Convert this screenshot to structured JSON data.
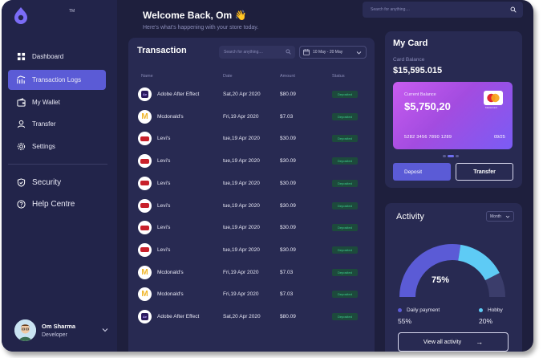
{
  "header": {
    "welcome": "Welcome Back, Om",
    "wave": "👋",
    "subtitle": "Here's what's happening with your store today.",
    "search_placeholder": "Search for anything...."
  },
  "sidebar": {
    "logo_tm": "TM",
    "items": [
      {
        "label": "Dashboard",
        "icon": "grid-icon"
      },
      {
        "label": "Transaction Logs",
        "icon": "chart-icon"
      },
      {
        "label": "My Wallet",
        "icon": "wallet-icon"
      },
      {
        "label": "Transfer",
        "icon": "user-icon"
      },
      {
        "label": "Settings",
        "icon": "gear-icon"
      },
      {
        "label": "Security",
        "icon": "shield-icon"
      },
      {
        "label": "Help Centre",
        "icon": "help-icon"
      }
    ],
    "active_index": 1,
    "profile": {
      "name": "Om Sharma",
      "role": "Developer"
    }
  },
  "transactions": {
    "title": "Transaction",
    "search_placeholder": "Search for anything....",
    "date_range": "10 May - 20 May",
    "columns": [
      "Name",
      "Date",
      "Amount",
      "Status"
    ],
    "rows": [
      {
        "name": "Adobe After Effect",
        "date": "Sat,20 Apr 2020",
        "amount": "$80.09",
        "status": "Deposited",
        "brand": "adobe"
      },
      {
        "name": "Mcdonald's",
        "date": "Fri,19 Apr 2020",
        "amount": "$7.03",
        "status": "Deposited",
        "brand": "mcdonalds"
      },
      {
        "name": "Levi's",
        "date": "tue,19 Apr 2020",
        "amount": "$30.09",
        "status": "Deposited",
        "brand": "levis"
      },
      {
        "name": "Levi's",
        "date": "tue,19 Apr 2020",
        "amount": "$30.09",
        "status": "Deposited",
        "brand": "levis"
      },
      {
        "name": "Levi's",
        "date": "tue,19 Apr 2020",
        "amount": "$30.09",
        "status": "Deposited",
        "brand": "levis"
      },
      {
        "name": "Levi's",
        "date": "tue,19 Apr 2020",
        "amount": "$30.09",
        "status": "Deposited",
        "brand": "levis"
      },
      {
        "name": "Levi's",
        "date": "tue,19 Apr 2020",
        "amount": "$30.09",
        "status": "Deposited",
        "brand": "levis"
      },
      {
        "name": "Levi's",
        "date": "tue,19 Apr 2020",
        "amount": "$30.09",
        "status": "Deposited",
        "brand": "levis"
      },
      {
        "name": "Mcdonald's",
        "date": "Fri,19 Apr 2020",
        "amount": "$7.03",
        "status": "Deposited",
        "brand": "mcdonalds"
      },
      {
        "name": "Mcdonald's",
        "date": "Fri,19 Apr 2020",
        "amount": "$7.03",
        "status": "Deposited",
        "brand": "mcdonalds"
      },
      {
        "name": "Adobe After Effect",
        "date": "Sat,20 Apr 2020",
        "amount": "$80.09",
        "status": "Deposited",
        "brand": "adobe"
      }
    ]
  },
  "card": {
    "title": "My Card",
    "balance_label": "Card Balance",
    "balance": "$15,595.015",
    "current_label": "Current Balance",
    "current": "$5,750,20",
    "brand_text": "Mastercard",
    "number": "5282 3456 7890 1289",
    "expiry": "09/25",
    "deposit_label": "Deposit",
    "transfer_label": "Transfer"
  },
  "activity": {
    "title": "Activity",
    "period": "Month",
    "percent_label": "75%",
    "daily_fraction": 0.55,
    "legend": [
      {
        "label": "Daily payment",
        "value": "55%",
        "color": "#5b5bd6"
      },
      {
        "label": "Hobby",
        "value": "20%",
        "color": "#5ecbf5"
      }
    ],
    "view_all": "View all activity",
    "arrow": "→"
  },
  "colors": {
    "accent": "#5b5bd6",
    "background": "#1e1f3d",
    "panel": "#282a52",
    "status_green": "#3ccf8e",
    "hobby": "#5ecbf5"
  }
}
